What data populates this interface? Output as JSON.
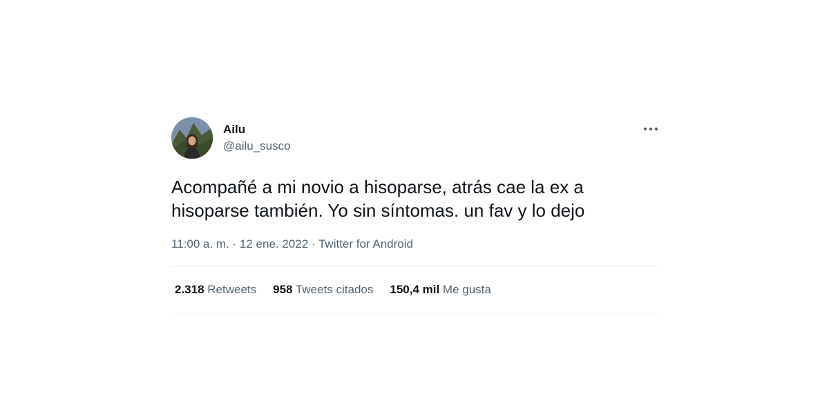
{
  "user": {
    "display_name": "Ailu",
    "handle": "@ailu_susco"
  },
  "tweet": {
    "text": "Acompañé a mi novio a hisoparse, atrás cae la ex a\nhisoparse también. Yo sin síntomas. un fav y lo dejo",
    "time": "11:00 a. m.",
    "separator": " · ",
    "date": "12 ene. 2022",
    "source": "Twitter for Android"
  },
  "stats": {
    "retweets": {
      "count": "2.318",
      "label": " Retweets"
    },
    "quotes": {
      "count": "958",
      "label": " Tweets citados"
    },
    "likes": {
      "count": "150,4 mil",
      "label": " Me gusta"
    }
  },
  "icons": {
    "more": "more-horizontal-icon"
  },
  "colors": {
    "text_primary": "#0f1419",
    "text_secondary": "#536471",
    "divider": "#eff3f4"
  }
}
